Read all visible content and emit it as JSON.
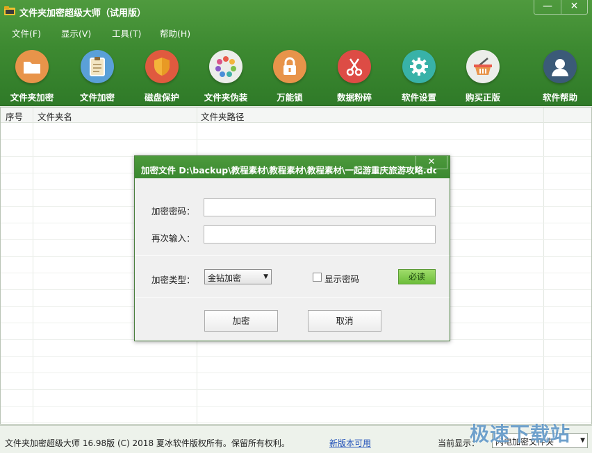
{
  "app": {
    "title": "文件夹加密超级大师（试用版）",
    "minimize": "—",
    "close": "✕"
  },
  "menu": [
    "文件(F)",
    "显示(V)",
    "工具(T)",
    "帮助(H)"
  ],
  "toolbar": [
    {
      "label": "文件夹加密",
      "icon": "folder-icon",
      "color": "#e8944a"
    },
    {
      "label": "文件加密",
      "icon": "document-icon",
      "color": "#5aa0d8"
    },
    {
      "label": "磁盘保护",
      "icon": "shield-icon",
      "color": "#e05a3f"
    },
    {
      "label": "文件夹伪装",
      "icon": "color-wheel-icon",
      "color": "#ecedea"
    },
    {
      "label": "万能锁",
      "icon": "lock-icon",
      "color": "#e8944a"
    },
    {
      "label": "数据粉碎",
      "icon": "scissors-icon",
      "color": "#dd4c45"
    },
    {
      "label": "软件设置",
      "icon": "gear-icon",
      "color": "#38b2a8"
    },
    {
      "label": "购买正版",
      "icon": "basket-icon",
      "color": "#ecedea"
    },
    {
      "label": "软件帮助",
      "icon": "user-help-icon",
      "color": "#3b5a78"
    }
  ],
  "table": {
    "columns": [
      "序号",
      "文件夹名",
      "文件夹路径"
    ]
  },
  "dialog": {
    "title": "加密文件 D:\\backup\\教程素材\\教程素材\\教程素材\\一起游重庆旅游攻略.doc",
    "close": "✕",
    "password_label": "加密密码：",
    "password_value": "",
    "confirm_label": "再次输入：",
    "confirm_value": "",
    "type_label": "加密类型：",
    "type_selected": "金钻加密",
    "show_password_label": "显示密码",
    "show_password_checked": false,
    "must_read_label": "必读",
    "encrypt_button": "加密",
    "cancel_button": "取消"
  },
  "status": {
    "copyright": "文件夹加密超级大师 16.98版 (C) 2018  夏冰软件版权所有。保留所有权利。",
    "new_version_link": "新版本可用",
    "current_show_label": "当前显示：",
    "current_show_value": "闪电加密文件夹"
  },
  "watermark": "极速下载站"
}
